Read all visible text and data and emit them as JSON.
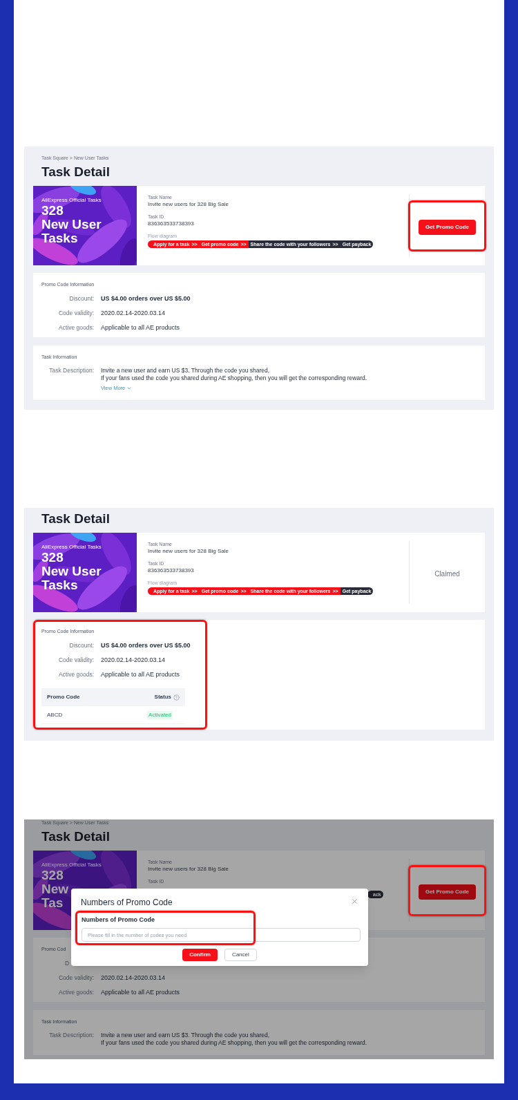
{
  "screens": [
    {
      "kind": "task",
      "dimmed": false,
      "breadcrumb": "Task Square > New User Tasks",
      "title": "Task Detail",
      "task": {
        "banner": {
          "brand": "AliExpress Official Tasks",
          "lines": [
            "328",
            "New User",
            "Tasks"
          ]
        },
        "fields": [
          {
            "label": "Task Name",
            "value": "Invite new users for 328 Big Sale"
          },
          {
            "label": "Task ID",
            "value": "836363533738393"
          }
        ],
        "flow": {
          "label": "Flow diagram",
          "kind": "full",
          "steps": [
            {
              "text": "Apply for a task",
              "arrow": ">>",
              "done": true
            },
            {
              "text": "Get promo code",
              "arrow": ">>",
              "done": true
            },
            {
              "text": "Share the code with your followers",
              "arrow": ">>",
              "done": false
            },
            {
              "text": "Get payback",
              "done": false
            }
          ]
        },
        "action": {
          "kind": "button",
          "text": "Get Promo Code",
          "highlighted": true
        }
      },
      "promo": {
        "title": "Promo Code Information",
        "highlighted": false,
        "rows": [
          {
            "label": "Discount:",
            "value": "US $4.00 orders over US $5.00",
            "bold": true
          },
          {
            "label": "Code validity:",
            "value": "2020.02.14-2020.03.14",
            "bold": false
          },
          {
            "label": "Active goods:",
            "value": "Applicable to all AE products",
            "bold": false
          }
        ]
      },
      "task_info": {
        "title": "Task Information",
        "label": "Task Description:",
        "lines": [
          "Invite a new user and earn US $3. Through the code you shared,",
          "If your fans used the code you shared during AE shopping, then you will get the corresponding reward."
        ],
        "link": "View More"
      }
    },
    {
      "kind": "claimed",
      "dimmed": false,
      "title": "Task Detail",
      "task": {
        "banner": {
          "brand": "AliExpress Official Tasks",
          "lines": [
            "328",
            "New User",
            "Tasks"
          ]
        },
        "fields": [
          {
            "label": "Task Name",
            "value": "Invite new users for 328 Big Sale"
          },
          {
            "label": "Task ID",
            "value": "836363533738393"
          }
        ],
        "flow": {
          "label": "Flow diagram",
          "kind": "full",
          "steps": [
            {
              "text": "Apply for a task",
              "arrow": ">>",
              "done": true
            },
            {
              "text": "Get promo code",
              "arrow": ">>",
              "done": true
            },
            {
              "text": "Share the code with your followers",
              "arrow": ">>",
              "done": true
            },
            {
              "text": "Get payback",
              "done": false
            }
          ]
        },
        "action": {
          "kind": "status",
          "text": "Claimed"
        }
      },
      "promo": {
        "title": "Promo Code Information",
        "highlighted": true,
        "rows": [
          {
            "label": "Discount:",
            "value": "US $4.00 orders over US $5.00",
            "bold": true
          },
          {
            "label": "Code validity:",
            "value": "2020.02.14-2020.03.14",
            "bold": false
          },
          {
            "label": "Active goods:",
            "value": "Applicable to all AE products",
            "bold": false
          }
        ],
        "table": {
          "columns": [
            {
              "text": "Promo Code",
              "kind": "code"
            },
            {
              "text": "Status",
              "kind": "status"
            }
          ],
          "rows": [
            [
              "ABCD",
              "Activated"
            ]
          ]
        }
      }
    },
    {
      "kind": "dialog",
      "dimmed": true,
      "breadcrumb": "Task Square > New User Tasks",
      "title": "Task Detail",
      "task": {
        "banner": {
          "brand": "AliExpress Official Tasks",
          "lines": [
            "328",
            "New",
            "Tas"
          ]
        },
        "fields": [
          {
            "label": "Task Name",
            "value": "Invite new users for 328 Big Sale"
          },
          {
            "label": "Task ID"
          }
        ],
        "flow": {
          "kind": "covered",
          "steps": [
            {
              "text": "ack",
              "done": false
            }
          ]
        },
        "action": {
          "kind": "button",
          "text": "Get Promo Code",
          "highlighted": true
        }
      },
      "promo": {
        "title": "Promo Cod",
        "highlighted": false,
        "rows": [
          {
            "label": "D",
            "kind": "cut"
          },
          {
            "label": "Code validity:",
            "value": "2020.02.14-2020.03.14",
            "bold": false
          },
          {
            "label": "Active goods:",
            "value": "Applicable to all AE products",
            "bold": false
          }
        ]
      },
      "task_info": {
        "title": "Task Information",
        "label": "Task Description:",
        "lines": [
          "Invite a new user and earn US $3. Through the code you shared,",
          "If your fans used the code you shared during AE shopping, then you will get the corresponding reward."
        ]
      },
      "modal": {
        "title": "Numbers of Promo Code",
        "field_label": "Numbers of Promo Code",
        "placeholder": "Please fill in the number of codes you need",
        "highlighted": true,
        "buttons": [
          {
            "text": "Confirm",
            "primary": true
          },
          {
            "text": "Cancel",
            "primary": false
          }
        ]
      }
    }
  ]
}
